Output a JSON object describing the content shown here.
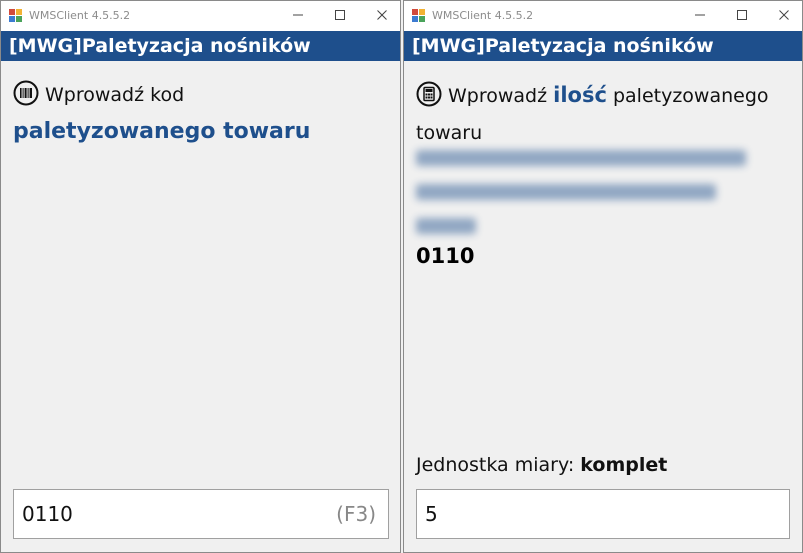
{
  "windows": [
    {
      "title": "WMSClient 4.5.5.2",
      "header": "[MWG]Paletyzacja nośników",
      "prompt_line1": "Wprowadź kod",
      "prompt_line2": "paletyzowanego towaru",
      "input_value": "0110",
      "input_hint": "(F3)"
    },
    {
      "title": "WMSClient 4.5.5.2",
      "header": "[MWG]Paletyzacja nośników",
      "prompt_pre": "Wprowadź",
      "prompt_bold": "ilość",
      "prompt_post": "paletyzowanego",
      "prompt_line2": "towaru",
      "product_code": "0110",
      "unit_label": "Jednostka miary:",
      "unit_value": "komplet",
      "input_value": "5"
    }
  ],
  "icons": {
    "app": "app-icon",
    "minimize": "minimize-icon",
    "maximize": "maximize-icon",
    "close": "close-icon",
    "barcode": "barcode-icon",
    "calculator": "calculator-icon"
  },
  "colors": {
    "header_bg": "#1e4f8c",
    "accent": "#1e4f8c"
  }
}
